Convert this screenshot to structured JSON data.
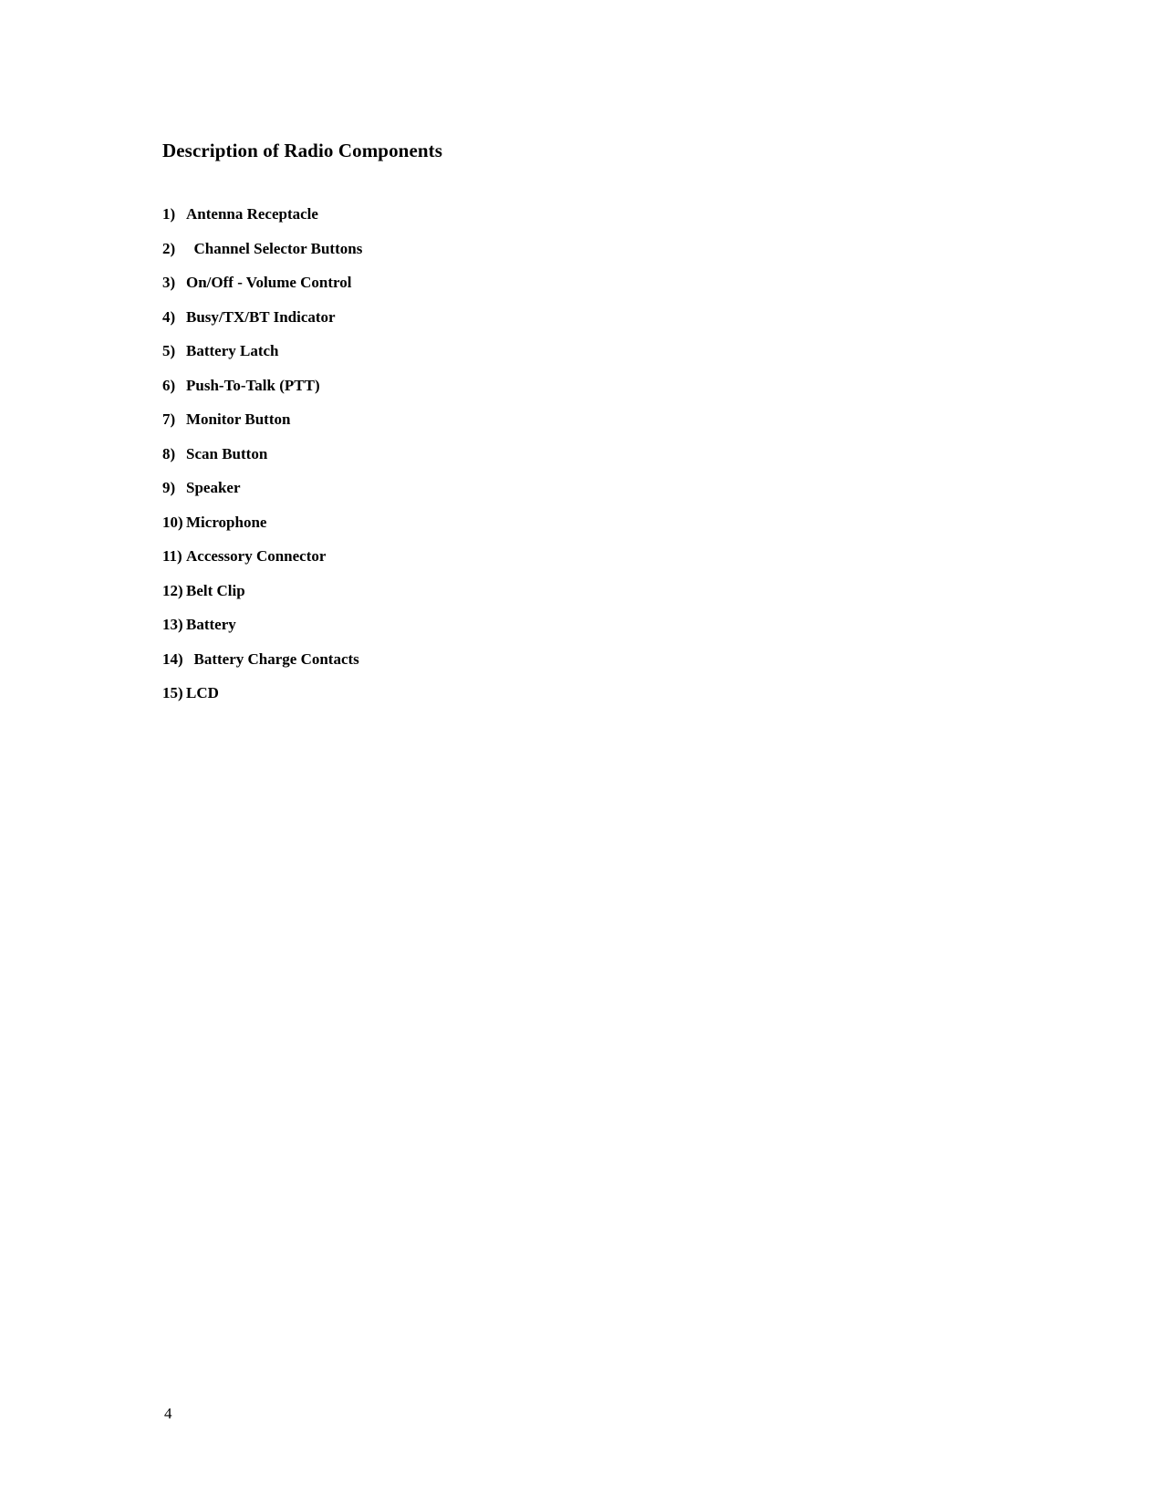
{
  "document": {
    "title": "Description of Radio Components",
    "page_number": "4",
    "background_color": "#ffffff",
    "text_color": "#000000"
  },
  "components": [
    {
      "number": "1)",
      "label": "Antenna Receptacle"
    },
    {
      "number": "2)",
      "label": "  Channel Selector Buttons"
    },
    {
      "number": "3)",
      "label": "On/Off - Volume Control"
    },
    {
      "number": "4)",
      "label": "Busy/TX/BT Indicator"
    },
    {
      "number": "5)",
      "label": "Battery Latch"
    },
    {
      "number": "6)",
      "label": "Push-To-Talk (PTT)"
    },
    {
      "number": "7)",
      "label": "Monitor Button"
    },
    {
      "number": "8)",
      "label": "Scan Button"
    },
    {
      "number": "9)",
      "label": "Speaker"
    },
    {
      "number": "10)",
      "label": "Microphone"
    },
    {
      "number": "11)",
      "label": "Accessory Connector"
    },
    {
      "number": "12)",
      "label": "Belt Clip"
    },
    {
      "number": "13)",
      "label": "Battery"
    },
    {
      "number": "14)",
      "label": "  Battery Charge Contacts"
    },
    {
      "number": "15)",
      "label": "LCD"
    }
  ]
}
